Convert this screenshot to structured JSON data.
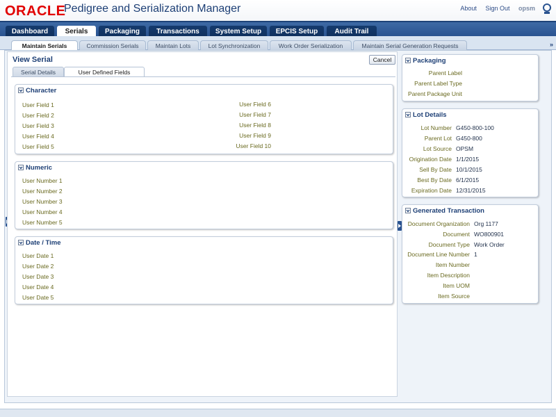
{
  "header": {
    "logo": "ORACLE",
    "title": "Pedigree and Serialization Manager",
    "links": {
      "about": "About",
      "signout": "Sign Out",
      "opsm": "opsm"
    }
  },
  "nav": {
    "tabs": [
      "Dashboard",
      "Serials",
      "Packaging",
      "Transactions",
      "System Setup",
      "EPCIS Setup",
      "Audit Trail"
    ],
    "active": "Serials"
  },
  "subnav": {
    "tabs": [
      "Maintain Serials",
      "Commission Serials",
      "Maintain Lots",
      "Lot Synchronization",
      "Work Order Serialization",
      "Maintain Serial Generation Requests"
    ],
    "more": "»"
  },
  "view": {
    "title": "View Serial",
    "cancel": "Cancel",
    "tabs": [
      "Serial Details",
      "User Defined Fields"
    ]
  },
  "character": {
    "title": "Character",
    "left": [
      "User Field 1",
      "User Field 2",
      "User Field 3",
      "User Field 4",
      "User Field 5"
    ],
    "right": [
      "User Field 6",
      "User Field 7",
      "User Field 8",
      "User Field 9",
      "User Field 10"
    ]
  },
  "numeric": {
    "title": "Numeric",
    "fields": [
      "User Number 1",
      "User Number 2",
      "User Number 3",
      "User Number 4",
      "User Number 5"
    ]
  },
  "datetime": {
    "title": "Date / Time",
    "fields": [
      "User Date 1",
      "User Date 2",
      "User Date 3",
      "User Date 4",
      "User Date 5"
    ]
  },
  "packaging": {
    "title": "Packaging",
    "labels": [
      "Parent Label",
      "Parent Label Type",
      "Parent Package Unit"
    ]
  },
  "lot_details": {
    "title": "Lot Details",
    "rows": [
      {
        "label": "Lot Number",
        "value": "G450-800-100"
      },
      {
        "label": "Parent Lot",
        "value": "G450-800"
      },
      {
        "label": "Lot Source",
        "value": "OPSM"
      },
      {
        "label": "Origination Date",
        "value": "1/1/2015"
      },
      {
        "label": "Sell By Date",
        "value": "10/1/2015"
      },
      {
        "label": "Best By Date",
        "value": "6/1/2015"
      },
      {
        "label": "Expiration Date",
        "value": "12/31/2015"
      }
    ]
  },
  "generated": {
    "title": "Generated Transaction",
    "rows": [
      {
        "label": "Document Organization",
        "value": "Org 1177"
      },
      {
        "label": "Document",
        "value": "WO800901"
      },
      {
        "label": "Document Type",
        "value": "Work Order"
      },
      {
        "label": "Document Line Number",
        "value": "1"
      },
      {
        "label": "Item Number",
        "value": ""
      },
      {
        "label": "Item Description",
        "value": ""
      },
      {
        "label": "Item UOM",
        "value": ""
      },
      {
        "label": "Item Source",
        "value": ""
      }
    ]
  },
  "colors": {
    "brand": "#e10000",
    "nav": "#2a5390",
    "accent": "#1d3f75"
  }
}
